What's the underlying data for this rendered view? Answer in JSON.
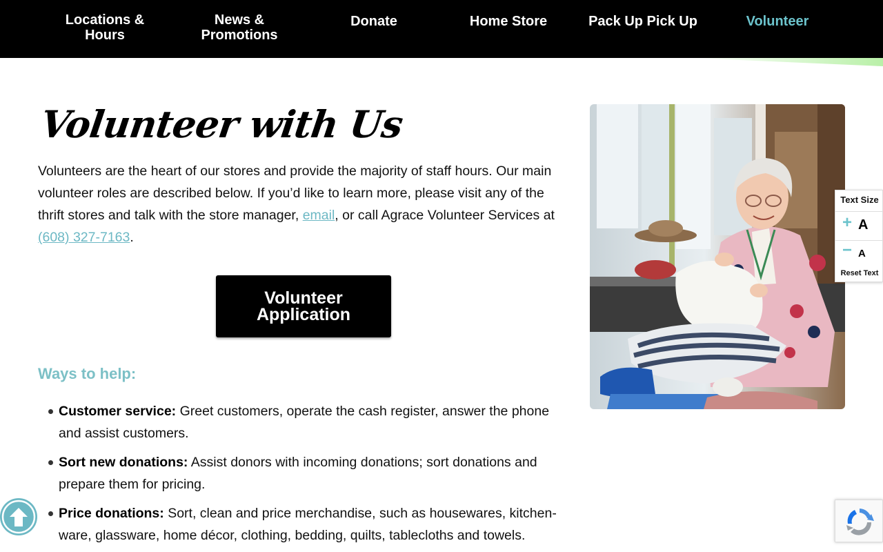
{
  "nav": {
    "items": [
      {
        "label": "Locations &\nHours",
        "line1": "Locations &",
        "line2": "Hours"
      },
      {
        "label": "News &\nPromotions",
        "line1": "News &",
        "line2": "Promotions"
      },
      {
        "label": "Donate"
      },
      {
        "label": "Home Store"
      },
      {
        "label": "Pack Up Pick Up"
      },
      {
        "label": "Volunteer"
      }
    ],
    "active_color": "#6cc3cc"
  },
  "main": {
    "title": "Volunteer with Us",
    "intro_part1": "Volunteers are the heart of our stores and provide the majority of staff hours. Our main volunteer roles are described below. If you’d like to learn more, please visit any of the thrift stores and talk with the store manager, ",
    "email_link": "email",
    "intro_part2": ", or call Agrace Volunteer Services at ",
    "phone_link": "(608) 327-7163",
    "intro_part3": ".",
    "button_line1": "Volunteer",
    "button_line2": "Application",
    "ways_title": "Ways to help:",
    "ways": [
      {
        "term": "Customer service:",
        "desc": " Greet customers, operate the cash register, answer the phone and assist customers."
      },
      {
        "term": "Sort new donations:",
        "desc": " Assist donors with incoming donations; sort donations and prepare them for pricing."
      },
      {
        "term": "Price donations:",
        "desc": " Sort, clean and price merchandise, such as housewares, kitchen-ware, glassware, home décor, clothing, bedding, quilts, tablecloths and towels."
      }
    ]
  },
  "text_size_widget": {
    "title": "Text Size",
    "increase_sign": "+",
    "decrease_sign": "−",
    "letter": "A",
    "reset": "Reset Text"
  },
  "colors": {
    "accent": "#6cb8c4",
    "nav_bg": "#000000",
    "ways_title": "#7cc0c6"
  }
}
